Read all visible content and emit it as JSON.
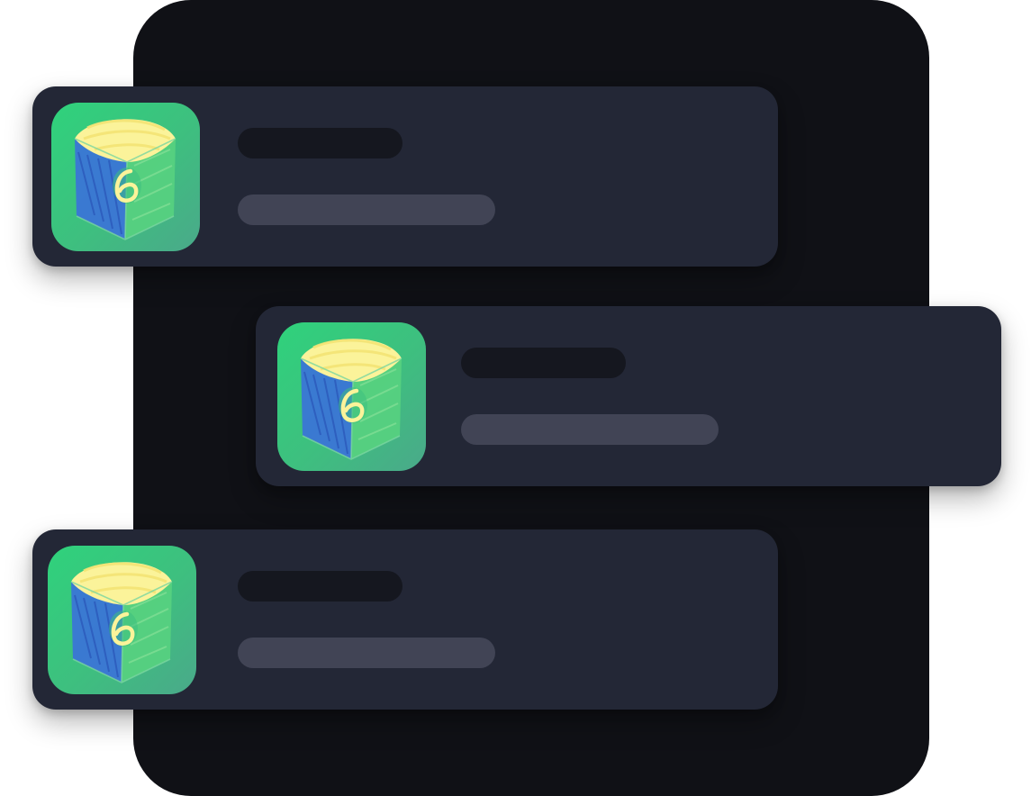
{
  "colors": {
    "backdrop": "#101116",
    "card": "#232736",
    "title_bar": "#15171f",
    "subtitle_bar": "#414455",
    "icon_green": "#2fd27c",
    "icon_blue": "#3b73d8",
    "icon_yellow": "#fbf39a"
  },
  "list": {
    "items": [
      {
        "icon": "sketched-box-app-icon",
        "title": "",
        "subtitle": ""
      },
      {
        "icon": "sketched-box-app-icon",
        "title": "",
        "subtitle": ""
      },
      {
        "icon": "sketched-box-app-icon",
        "title": "",
        "subtitle": ""
      }
    ]
  }
}
